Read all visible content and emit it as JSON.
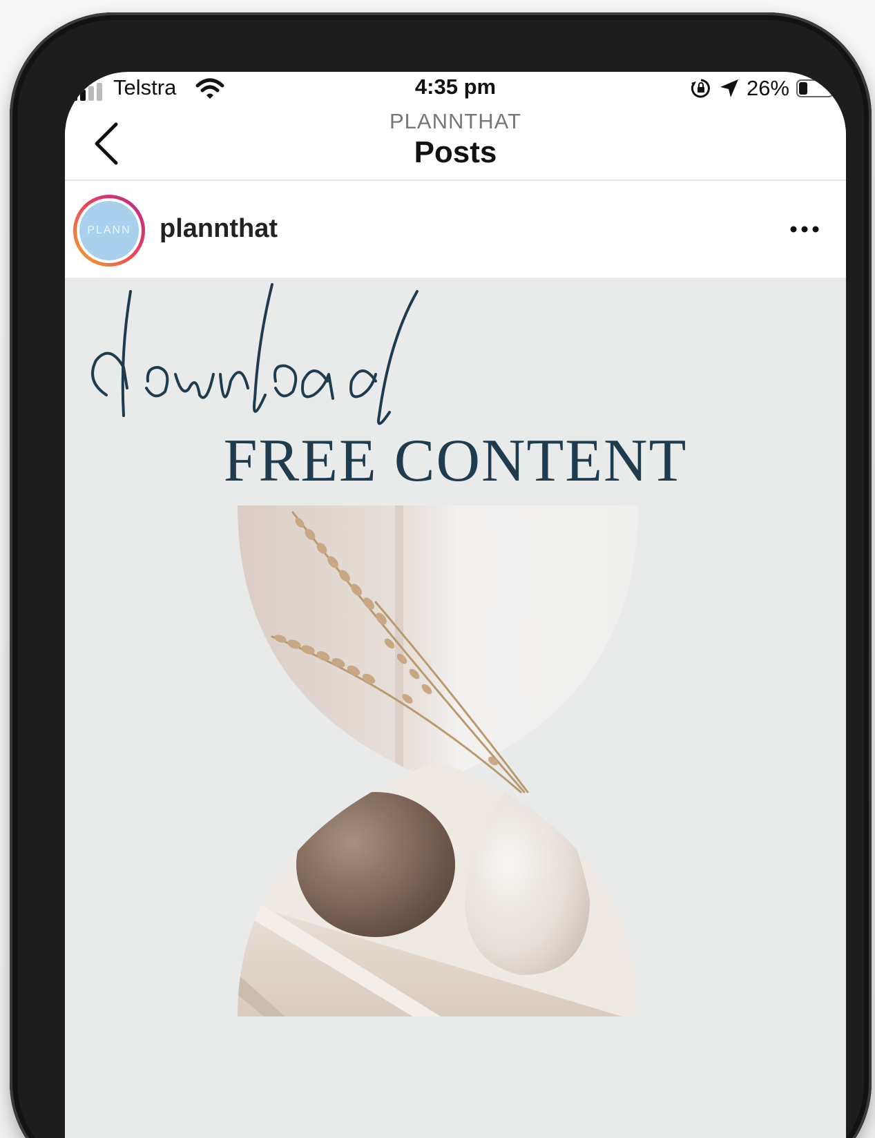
{
  "status_bar": {
    "carrier": "Telstra",
    "time": "4:35 pm",
    "battery_percent": "26%",
    "battery_level": 0.26,
    "icons": [
      "signal-icon",
      "wifi-icon",
      "orientation-lock-icon",
      "location-arrow-icon",
      "battery-icon"
    ]
  },
  "header": {
    "subtitle": "PLANNTHAT",
    "title": "Posts",
    "back_icon": "chevron-left-icon"
  },
  "post": {
    "avatar_text": "PLANN",
    "username": "plannthat",
    "more_icon": "ellipsis-icon",
    "image": {
      "headline": "FREE CONTENT",
      "script_word": "download",
      "text_color": "#1f3c4f",
      "background_color": "#e9eaea"
    }
  },
  "colors": {
    "avatar_ring_start": "#f5a623",
    "avatar_ring_end": "#b7258c",
    "avatar_fill": "#a9d0ec"
  }
}
